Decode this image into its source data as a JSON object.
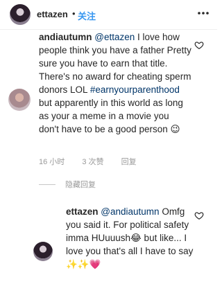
{
  "header": {
    "username": "ettazen",
    "separator": "•",
    "follow_label": "关注"
  },
  "comment": {
    "username": "andiautumn",
    "mention": "@ettazen",
    "text_a": "I love how people think you have a father Pretty sure you have to earn that title. There's no award for cheating sperm donors LOL",
    "hashtag": "#earnyourparenthood",
    "text_b": "but apparently in this world as long as your a meme in a movie you don't have to be a good person 😉",
    "time": "16 小时",
    "likes": "3 次赞",
    "reply_label": "回复"
  },
  "hidden_replies_label": "隐藏回复",
  "reply": {
    "username": "ettazen",
    "mention": "@andiautumn",
    "text": "Omfg you said it. For political safety imma HUuuush😂 but like... I love you that's all I have to say ✨✨💗"
  }
}
